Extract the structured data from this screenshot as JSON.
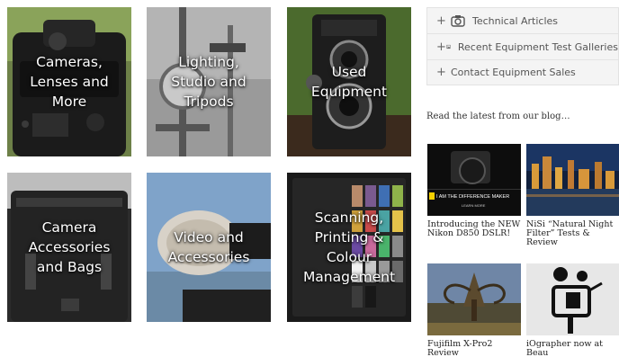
{
  "tiles": [
    {
      "label": "Cameras,\nLenses and\nMore"
    },
    {
      "label": "Lighting,\nStudio and\nTripods"
    },
    {
      "label": "Used\nEquipment"
    },
    {
      "label": "Camera\nAccessories\nand Bags"
    },
    {
      "label": "Video and\nAccessories"
    },
    {
      "label": "Scanning,\nPrinting &\nColour\nManagement"
    }
  ],
  "menu": {
    "items": [
      {
        "label": "Technical Articles",
        "icon": "camera-icon"
      },
      {
        "label": "Recent Equipment Test Galleries",
        "icon": "image-icon"
      },
      {
        "label": "Contact Equipment Sales",
        "icon": ""
      }
    ],
    "toggle_glyph": "+"
  },
  "blog": {
    "heading": "Read the latest from our blog…",
    "posts": [
      {
        "title": "Introducing the NEW Nikon D850 DSLR!",
        "thumb_text": "I AM THE DIFFERENCE MAKER",
        "thumb_sub": "LEARN MORE"
      },
      {
        "title": "NiSi “Natural Night Filter” Tests & Review"
      },
      {
        "title": "Fujifilm X-Pro2 Review"
      },
      {
        "title": "iOgrapher now at Beau"
      }
    ]
  },
  "colors": {
    "menu_bg": "#f4f4f4",
    "menu_border": "#e3e3e3",
    "caption": "#ffffff"
  }
}
